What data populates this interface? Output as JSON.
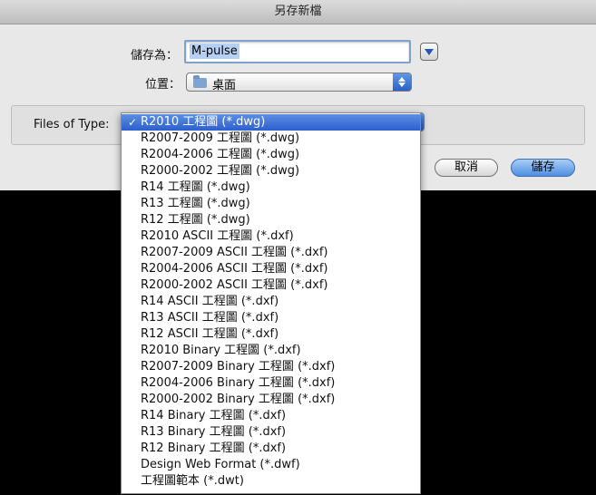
{
  "window": {
    "title": "另存新檔"
  },
  "save_as": {
    "label": "儲存為：",
    "value": "M-pulse"
  },
  "location": {
    "label": "位置：",
    "value": "桌面"
  },
  "file_type": {
    "label": "Files of Type:",
    "items": [
      "R2010 工程圖 (*.dwg)",
      "R2007-2009 工程圖 (*.dwg)",
      "R2004-2006 工程圖 (*.dwg)",
      "R2000-2002 工程圖 (*.dwg)",
      "R14 工程圖 (*.dwg)",
      "R13 工程圖 (*.dwg)",
      "R12 工程圖 (*.dwg)",
      "R2010 ASCII 工程圖 (*.dxf)",
      "R2007-2009 ASCII 工程圖 (*.dxf)",
      "R2004-2006 ASCII 工程圖 (*.dxf)",
      "R2000-2002 ASCII 工程圖 (*.dxf)",
      "R14 ASCII 工程圖 (*.dxf)",
      "R13 ASCII 工程圖 (*.dxf)",
      "R12 ASCII 工程圖 (*.dxf)",
      "R2010 Binary 工程圖 (*.dxf)",
      "R2007-2009 Binary 工程圖 (*.dxf)",
      "R2004-2006 Binary 工程圖 (*.dxf)",
      "R2000-2002 Binary 工程圖 (*.dxf)",
      "R14 Binary 工程圖 (*.dxf)",
      "R13 Binary 工程圖 (*.dxf)",
      "R12 Binary 工程圖 (*.dxf)",
      "Design Web Format (*.dwf)",
      "工程圖範本 (*.dwt)"
    ],
    "selected_index": 0,
    "check_mark": "✓"
  },
  "buttons": {
    "cancel": "取消",
    "save": "儲存"
  },
  "colors": {
    "accent": "#2c5fcf",
    "selection": "#b5d0f2"
  },
  "icons": {
    "location": "folder-icon",
    "expand": "disclosure-arrow-icon"
  }
}
